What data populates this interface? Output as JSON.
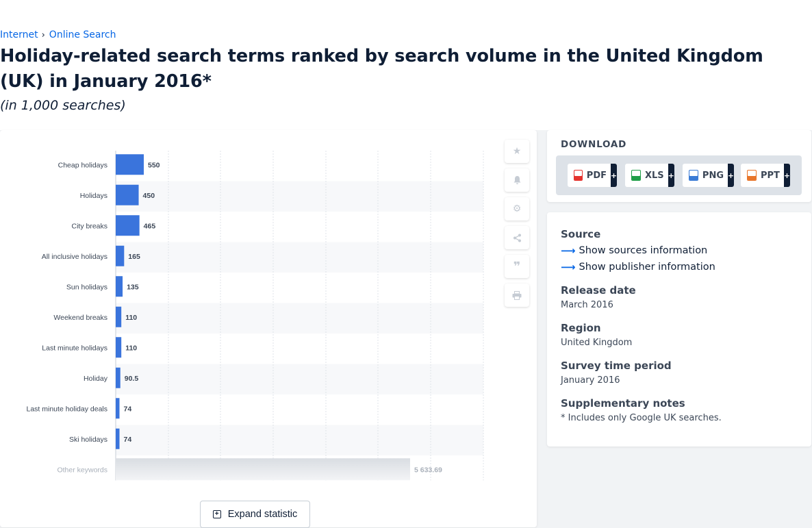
{
  "breadcrumb": {
    "items": [
      "Internet",
      "Online Search"
    ],
    "separator": "›"
  },
  "title": "Holiday-related search terms ranked by search volume in the United Kingdom (UK) in January 2016*",
  "subtitle": "(in 1,000 searches)",
  "expand_button": {
    "label": "Expand statistic"
  },
  "tools": [
    "star-icon",
    "bell-icon",
    "gear-icon",
    "share-icon",
    "quote-icon",
    "print-icon"
  ],
  "download": {
    "title": "DOWNLOAD",
    "formats": [
      {
        "label": "PDF",
        "color": "#e5322d",
        "plus": "+"
      },
      {
        "label": "XLS",
        "color": "#1f9e48",
        "plus": "+"
      },
      {
        "label": "PNG",
        "color": "#3a7bd5",
        "plus": "+"
      },
      {
        "label": "PPT",
        "color": "#e8762b",
        "plus": "+"
      }
    ]
  },
  "info": {
    "source_heading": "Source",
    "show_sources": "Show sources information",
    "show_publisher": "Show publisher information",
    "release_heading": "Release date",
    "release_value": "March 2016",
    "region_heading": "Region",
    "region_value": "United Kingdom",
    "survey_heading": "Survey time period",
    "survey_value": "January 2016",
    "notes_heading": "Supplementary notes",
    "notes_value": "* Includes only Google UK searches."
  },
  "colors": {
    "bar": "#3a74dc",
    "other_bar": "#e3e6ea",
    "accent": "#0666e5"
  },
  "chart_data": {
    "type": "bar",
    "orientation": "horizontal",
    "categories": [
      "Cheap holidays",
      "Holidays",
      "City breaks",
      "All inclusive holidays",
      "Sun holidays",
      "Weekend breaks",
      "Last minute holidays",
      "Holiday",
      "Last minute holiday deals",
      "Ski holidays"
    ],
    "values": [
      550,
      450,
      465,
      165,
      135,
      110,
      110,
      90.5,
      74,
      74
    ],
    "value_labels": [
      "550",
      "450",
      "465",
      "165",
      "135",
      "110",
      "110",
      "90.5",
      "74",
      "74"
    ],
    "other": {
      "label": "Other keywords",
      "value": 5633.69,
      "value_label": "5 633.69"
    },
    "xlim": [
      0,
      7000
    ],
    "grid": true,
    "legend": "none"
  }
}
